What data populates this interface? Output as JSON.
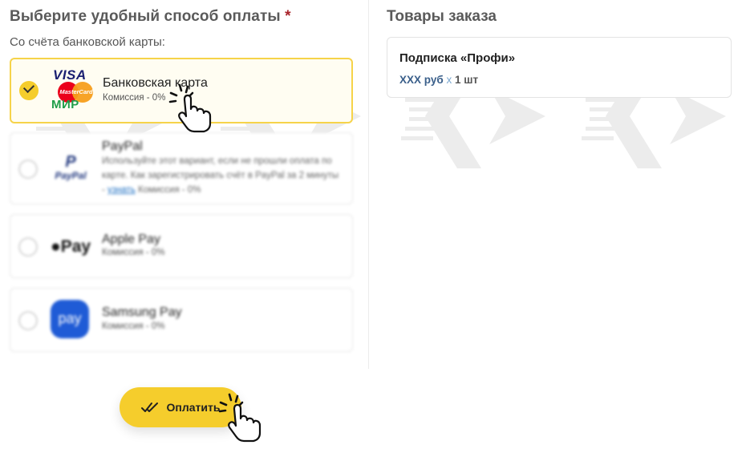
{
  "payment_section": {
    "title": "Выберите удобный способ оплаты",
    "required_mark": "*",
    "subtitle": "Со счёта банковской карты:",
    "options": [
      {
        "name": "Банковская карта",
        "fee": "Комиссия - 0%",
        "selected": true,
        "logos": {
          "visa": "VISA",
          "mastercard": "MasterCard",
          "mir": "МИР"
        }
      },
      {
        "name": "PayPal",
        "desc_before": "Используйте этот вариант, если не прошли оплата по карте. Как зарегистрировать счёт в PayPal за 2 минуты - ",
        "desc_link": "узнать",
        "desc_after": " Комиссия - 0%",
        "selected": false,
        "logo_text": "PayPal"
      },
      {
        "name": "Apple Pay",
        "fee": "Комиссия - 0%",
        "selected": false,
        "logo_text": "Pay"
      },
      {
        "name": "Samsung Pay",
        "fee": "Комиссия - 0%",
        "selected": false,
        "logo_text": "pay"
      }
    ],
    "pay_button": {
      "label": "Оплатить",
      "icon": "double-check-icon"
    }
  },
  "order": {
    "title": "Товары заказа",
    "item": {
      "name": "Подписка «Профи»",
      "price": "ХХХ руб",
      "times": "х",
      "qty": "1 шт"
    }
  },
  "colors": {
    "accent_yellow": "#f5cd2c",
    "required_red": "#a8242b",
    "price_blue": "#3a5f8a"
  }
}
